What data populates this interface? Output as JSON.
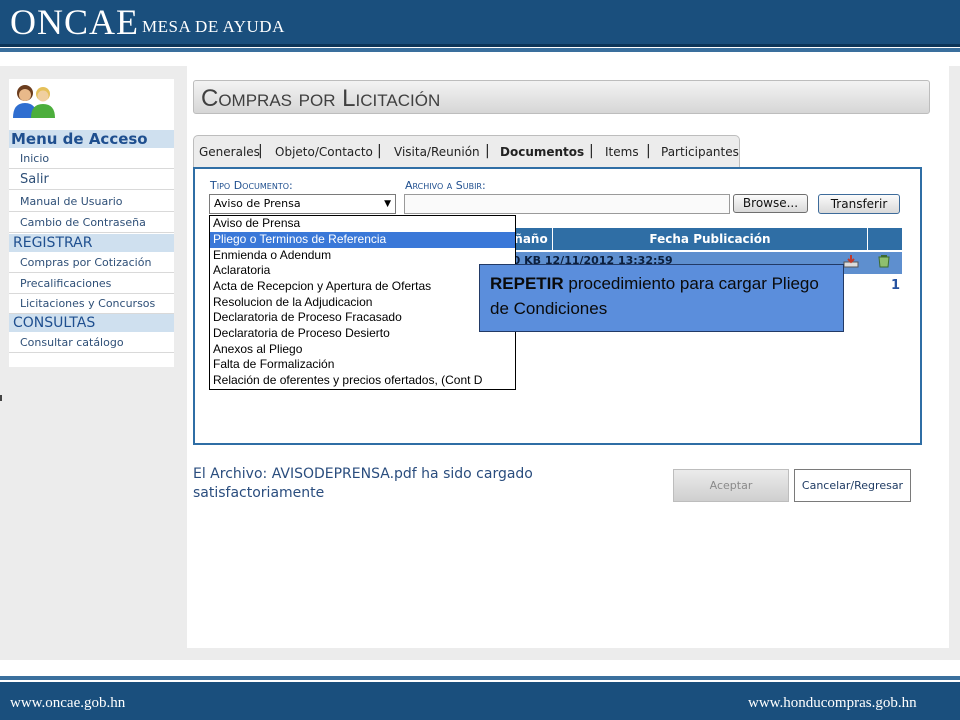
{
  "header": {
    "brand": "ONCAE",
    "subtitle": "MESA DE AYUDA"
  },
  "sidebar": {
    "sections": [
      {
        "title": "Menu de Acceso",
        "items": [
          "Inicio",
          "Salir",
          "Manual de Usuario",
          "Cambio de Contraseña"
        ]
      },
      {
        "title": "REGISTRAR",
        "items": [
          "Compras por Cotización",
          "Precalificaciones",
          "Licitaciones y Concursos"
        ]
      },
      {
        "title": "CONSULTAS",
        "items": [
          "Consultar catálogo"
        ]
      }
    ]
  },
  "page_title": "Compras por Licitación",
  "tabs": [
    {
      "label": "Generales",
      "active": false
    },
    {
      "label": "Objeto/Contacto",
      "active": false
    },
    {
      "label": "Visita/Reunión",
      "active": false
    },
    {
      "label": "Documentos",
      "active": true
    },
    {
      "label": "Items",
      "active": false
    },
    {
      "label": "Participantes",
      "active": false
    }
  ],
  "form": {
    "tipo_documento_label": "Tipo Documento:",
    "tipo_documento_value": "Aviso de Prensa",
    "archivo_label": "Archivo a Subir:",
    "browse_label": "Browse...",
    "transfer_label": "Transferir"
  },
  "dropdown_options": [
    "Aviso de Prensa",
    "Pliego o Terminos de Referencia",
    "Enmienda o Adendum",
    "Aclaratoria",
    "Acta de Recepcion y Apertura de Ofertas",
    "Resolucion de la Adjudicacion",
    "Declaratoria de Proceso Fracasado",
    "Declaratoria de Proceso Desierto",
    "Anexos al Pliego",
    "Falta de Formalización",
    "Relación de oferentes y precios ofertados, (Cont D"
  ],
  "dropdown_selected_index": 1,
  "table": {
    "headers": [
      "ñaño",
      "Fecha Publicación"
    ],
    "row_text": "00 KB 12/11/2012 13:32:59",
    "pagination": "1"
  },
  "callout": {
    "bold": "REPETIR",
    "text": " procedimiento para cargar Pliego de Condiciones"
  },
  "message": "El Archivo: AVISODEPRENSA.pdf ha sido cargado satisfactoriamente",
  "buttons": {
    "aceptar": "Aceptar",
    "cancelar": "Cancelar/Regresar"
  },
  "footer": {
    "left": "www.oncae.gob.hn",
    "right": "www.honducompras.gob.hn"
  }
}
